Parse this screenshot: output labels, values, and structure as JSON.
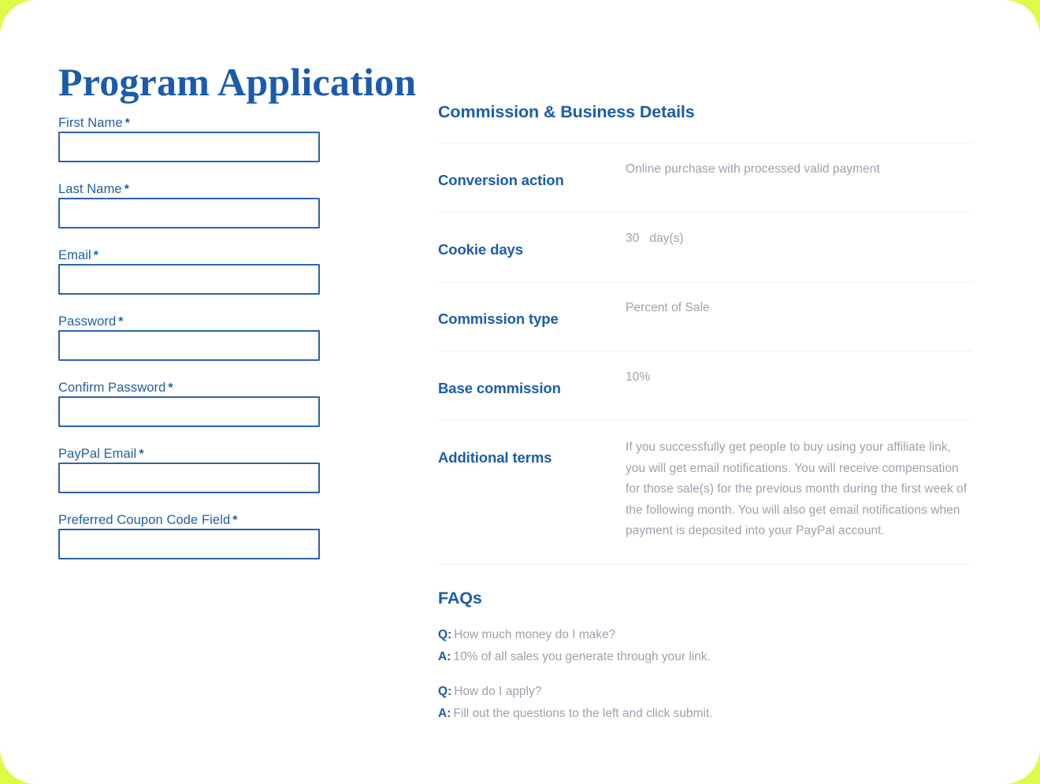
{
  "theme": {
    "frame_color": "#ddfc4a",
    "card_background": "#ffffff",
    "title_blue": "#1a5cab",
    "label_blue": "#1f5fa8",
    "value_gray": "#9aa2ac",
    "input_border": "#2c63ab",
    "divider": "#eef1f5"
  },
  "page": {
    "title": "Program Application"
  },
  "form": {
    "fields": [
      {
        "label": "First Name",
        "required": "*",
        "value": "",
        "placeholder": ""
      },
      {
        "label": "Last Name",
        "required": "*",
        "value": "",
        "placeholder": ""
      },
      {
        "label": "Email",
        "required": "*",
        "value": "",
        "placeholder": ""
      },
      {
        "label": "Password",
        "required": "*",
        "value": "",
        "placeholder": ""
      },
      {
        "label": "Confirm Password",
        "required": "*",
        "value": "",
        "placeholder": ""
      },
      {
        "label": "PayPal Email",
        "required": "*",
        "value": "",
        "placeholder": ""
      },
      {
        "label": "Preferred Coupon Code Field",
        "required": "*",
        "value": "",
        "placeholder": ""
      }
    ]
  },
  "details": {
    "heading": "Commission & Business Details",
    "rows": [
      {
        "label": "Conversion action",
        "value": "Online purchase with processed valid payment"
      },
      {
        "label": "Cookie days",
        "value_number": "30",
        "value_unit": "day(s)"
      },
      {
        "label": "Commission type",
        "value": "Percent of Sale"
      },
      {
        "label": "Base commission",
        "value": "10%"
      },
      {
        "label": "Additional terms",
        "value": "If you successfully get people to buy using your affiliate link, you will get email notifications. You will receive compensation for those sale(s) for the previous month during the first week of the following month. You will also get email notifications when payment is deposited into your PayPal account."
      }
    ]
  },
  "faqs": {
    "heading": "FAQs",
    "question_tag": "Q:",
    "answer_tag": "A:",
    "items": [
      {
        "question": "How much money do I make?",
        "answer": "10% of all sales you generate through your link."
      },
      {
        "question": "How do I apply?",
        "answer": "Fill out the questions to the left and click submit."
      }
    ]
  }
}
